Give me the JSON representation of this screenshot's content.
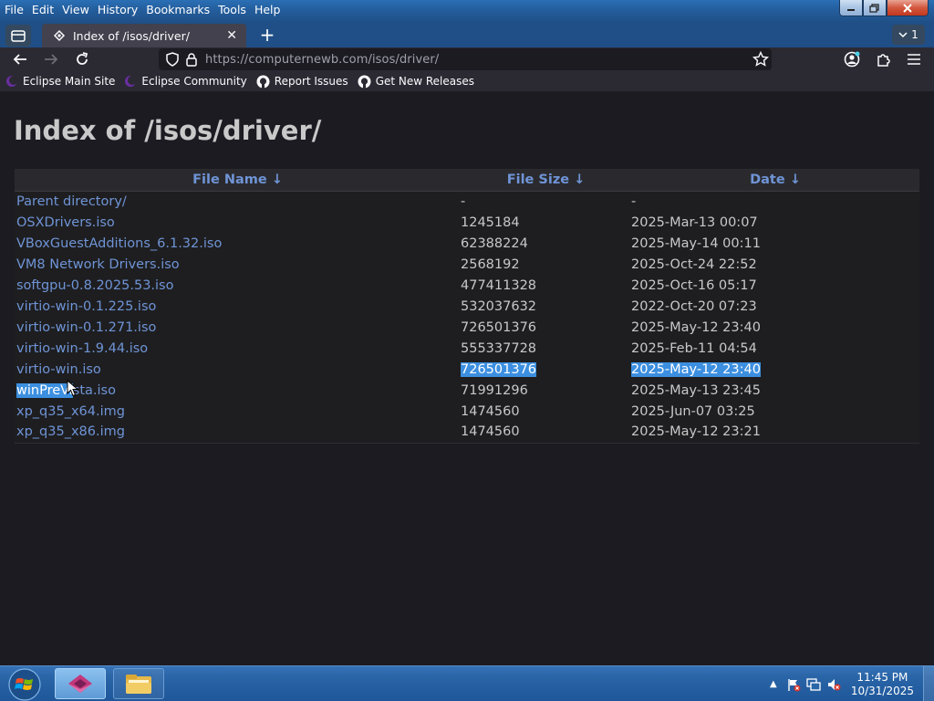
{
  "menu": [
    "File",
    "Edit",
    "View",
    "History",
    "Bookmarks",
    "Tools",
    "Help"
  ],
  "tab": {
    "title": "Index of /isos/driver/",
    "count": "1"
  },
  "url": {
    "host": "https://computernewb.com",
    "path": "/isos/driver/"
  },
  "bookmarks": [
    "Eclipse Main Site",
    "Eclipse Community",
    "Report Issues",
    "Get New Releases"
  ],
  "page": {
    "title": "Index of /isos/driver/",
    "headers": {
      "name": "File Name  ↓",
      "size": "File Size  ↓",
      "date": "Date  ↓"
    },
    "rows": [
      {
        "name": "Parent directory/",
        "size": "-",
        "date": "-"
      },
      {
        "name": "OSXDrivers.iso",
        "size": "1245184",
        "date": "2025-Mar-13 00:07"
      },
      {
        "name": "VBoxGuestAdditions_6.1.32.iso",
        "size": "62388224",
        "date": "2025-May-14 00:11"
      },
      {
        "name": "VM8 Network Drivers.iso",
        "size": "2568192",
        "date": "2025-Oct-24 22:52"
      },
      {
        "name": "softgpu-0.8.2025.53.iso",
        "size": "477411328",
        "date": "2025-Oct-16 05:17"
      },
      {
        "name": "virtio-win-0.1.225.iso",
        "size": "532037632",
        "date": "2022-Oct-20 07:23"
      },
      {
        "name": "virtio-win-0.1.271.iso",
        "size": "726501376",
        "date": "2025-May-12 23:40"
      },
      {
        "name": "virtio-win-1.9.44.iso",
        "size": "555337728",
        "date": "2025-Feb-11 04:54"
      },
      {
        "name": "virtio-win.iso",
        "size": "726501376",
        "date": "2025-May-12 23:40"
      },
      {
        "name_selected": "winPreVi",
        "name_rest": "sta.iso",
        "size": "71991296",
        "date": "2025-May-13 23:45"
      },
      {
        "name": "xp_q35_x64.img",
        "size": "1474560",
        "date": "2025-Jun-07 03:25"
      },
      {
        "name": "xp_q35_x86.img",
        "size": "1474560",
        "date": "2025-May-12 23:21"
      }
    ]
  },
  "clock": {
    "time": "11:45 PM",
    "date": "10/31/2025"
  },
  "colors": {
    "link": "#6f94d6",
    "selection": "#3c8fe0",
    "background": "#1c1b22"
  }
}
